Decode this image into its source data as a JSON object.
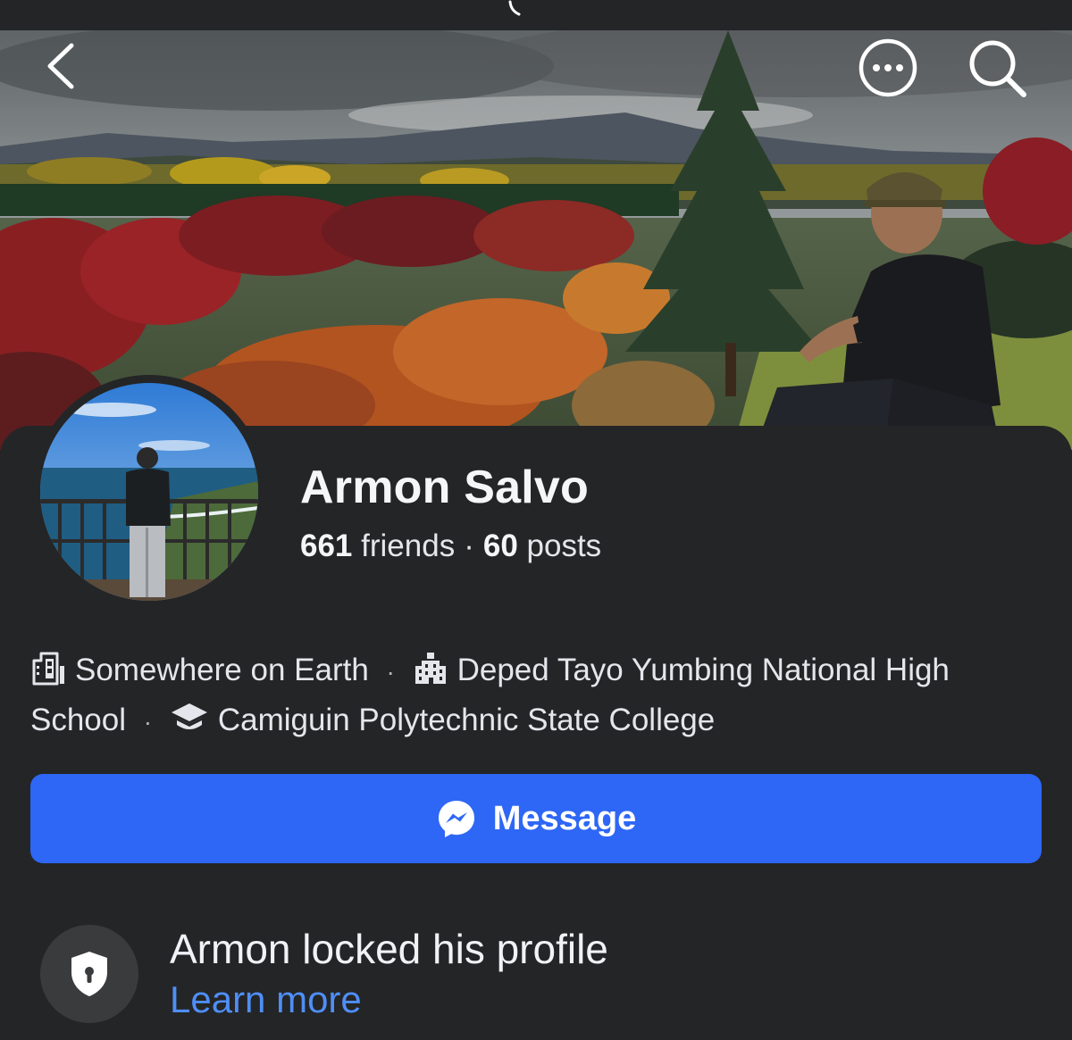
{
  "header": {
    "back_icon": "chevron-left-icon",
    "more_icon": "more-horizontal-circle-icon",
    "search_icon": "search-icon"
  },
  "profile": {
    "name": "Armon Salvo",
    "friends_count": "661",
    "friends_label": "friends",
    "separator": "·",
    "posts_count": "60",
    "posts_label": "posts"
  },
  "details": {
    "location": "Somewhere on Earth",
    "high_school": "Deped Tayo Yumbing National High School",
    "college": "Camiguin Polytechnic State College",
    "separator": "·"
  },
  "actions": {
    "message_label": "Message",
    "message_icon": "messenger-icon"
  },
  "lock_notice": {
    "title": "Armon locked his profile",
    "link": "Learn more",
    "icon": "shield-lock-icon"
  },
  "colors": {
    "background": "#242526",
    "accent": "#2e67f5",
    "link": "#4f8ef7"
  }
}
